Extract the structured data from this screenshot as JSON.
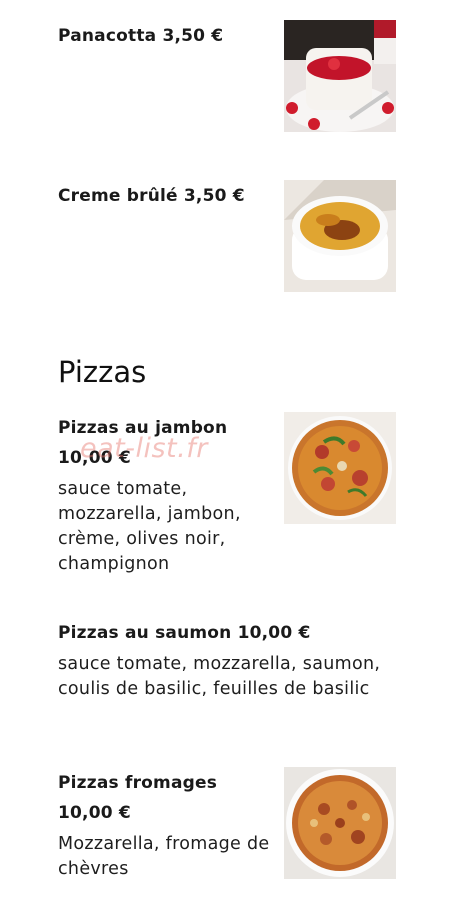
{
  "desserts": [
    {
      "title": "Panacotta 3,50 €",
      "image": "panacotta-photo"
    },
    {
      "title": "Creme brûlé 3,50 €",
      "image": "creme-brulee-photo"
    }
  ],
  "pizzas_section": {
    "heading": "Pizzas",
    "items": [
      {
        "title_line1": "Pizzas au jambon",
        "title_line2": "10,00 €",
        "description": "sauce tomate, mozzarella, jambon, crème, olives noir, champignon",
        "image": "pizza-jambon-photo"
      },
      {
        "title": "Pizzas au saumon 10,00 €",
        "description": "sauce tomate, mozzarella, saumon, coulis de basilic, feuilles de basilic"
      },
      {
        "title_line1": "Pizzas fromages",
        "title_line2": "10,00 €",
        "description": "Mozzarella, fromage de chèvres",
        "image": "pizza-fromages-photo"
      }
    ]
  },
  "watermark": "eat-list.fr"
}
